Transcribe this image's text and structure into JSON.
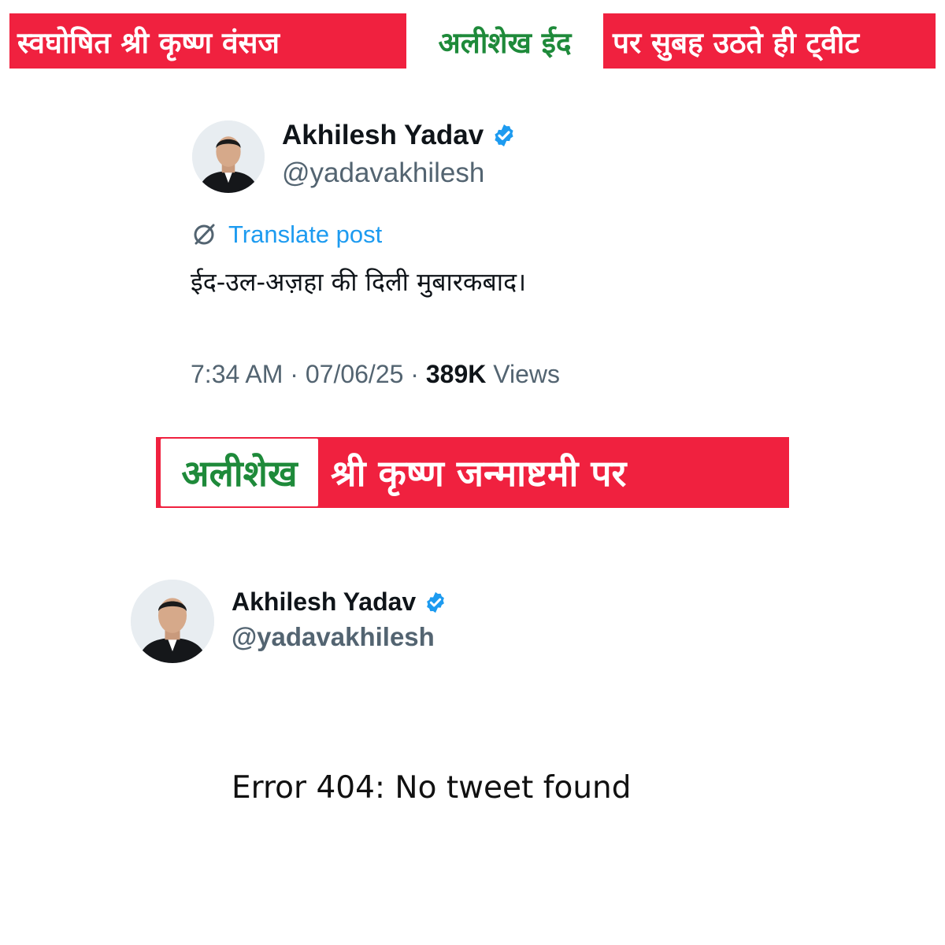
{
  "banner_top": {
    "part1": "स्वघोषित श्री कृष्ण वंसज",
    "part2": "अलीशेख ईद",
    "part3": "पर सुबह उठते ही ट्वीट"
  },
  "tweet1": {
    "name": "Akhilesh Yadav",
    "handle": "@yadavakhilesh",
    "translate_label": "Translate post",
    "text": "ईद-उल-अज़हा की दिली मुबारकबाद।",
    "time": "7:34 AM",
    "date": "07/06/25",
    "separator": "·",
    "views_count": "389K",
    "views_label": "Views"
  },
  "banner_mid": {
    "part1": "अलीशेख",
    "part2": "श्री कृष्ण जन्माष्टमी पर"
  },
  "tweet2": {
    "name": "Akhilesh Yadav",
    "handle": "@yadavakhilesh"
  },
  "error_message": "Error 404: No tweet found",
  "colors": {
    "banner_red": "#f0213f",
    "banner_green_text": "#1e8a3a",
    "link_blue": "#1d9bf0",
    "verified_blue": "#1d9bf0",
    "muted_gray": "#536471"
  },
  "icons": [
    "verified-badge-icon",
    "translate-icon",
    "profile-avatar"
  ]
}
